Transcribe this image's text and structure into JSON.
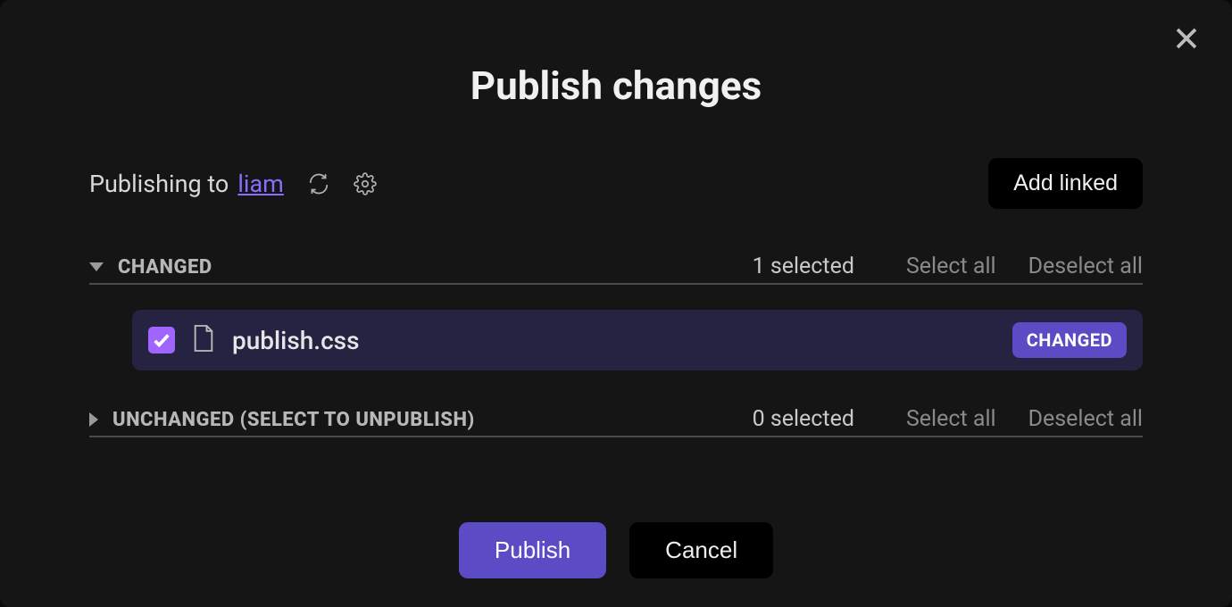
{
  "title": "Publish changes",
  "publishing": {
    "prefix": "Publishing to",
    "target": "liam"
  },
  "buttons": {
    "add_linked": "Add linked",
    "publish": "Publish",
    "cancel": "Cancel"
  },
  "sections": {
    "changed": {
      "title": "CHANGED",
      "selected_text": "1 selected",
      "select_all": "Select all",
      "deselect_all": "Deselect all",
      "items": [
        {
          "name": "publish.css",
          "badge": "CHANGED",
          "checked": true
        }
      ]
    },
    "unchanged": {
      "title": "UNCHANGED (SELECT TO UNPUBLISH)",
      "selected_text": "0 selected",
      "select_all": "Select all",
      "deselect_all": "Deselect all"
    }
  }
}
